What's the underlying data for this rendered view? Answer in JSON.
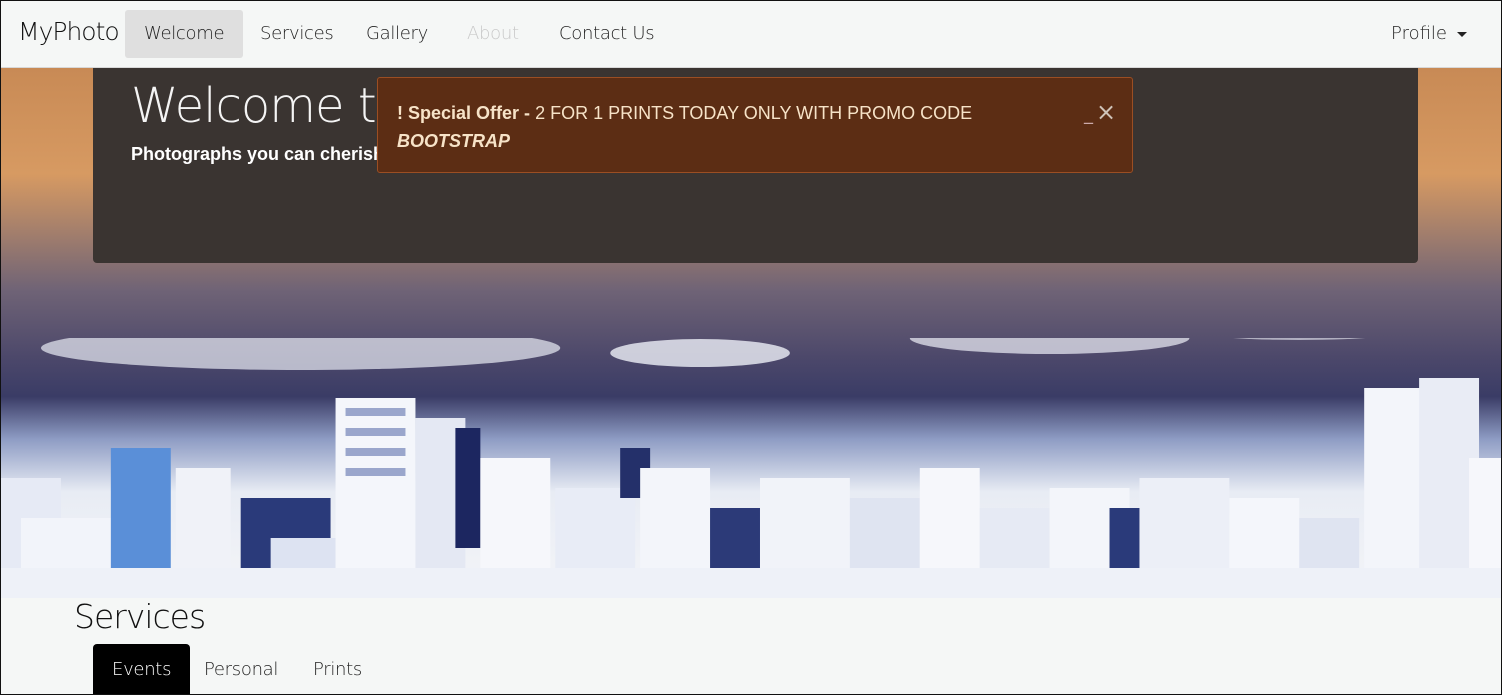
{
  "navbar": {
    "brand": "MyPhoto",
    "items": [
      {
        "label": "Welcome",
        "state": "active"
      },
      {
        "label": "Services",
        "state": "normal"
      },
      {
        "label": "Gallery",
        "state": "normal"
      },
      {
        "label": "About",
        "state": "disabled"
      },
      {
        "label": "Contact Us",
        "state": "normal"
      }
    ],
    "profile_label": "Profile"
  },
  "hero": {
    "title": "Welcome to",
    "subtitle": "Photographs you can cherish!"
  },
  "alert": {
    "icon": "!",
    "prefix": "Special Offer - ",
    "message": "2 FOR 1 PRINTS TODAY ONLY WITH PROMO CODE",
    "code": "BOOTSTRAP",
    "minimize_glyph": "_",
    "close_glyph": "×"
  },
  "services": {
    "title": "Services",
    "tabs": [
      {
        "label": "Events",
        "state": "active"
      },
      {
        "label": "Personal",
        "state": "normal"
      },
      {
        "label": "Prints",
        "state": "normal"
      }
    ]
  },
  "colors": {
    "alert_bg": "#5c2d14",
    "jumbotron_bg": "#3a3431",
    "tab_active_bg": "#000000",
    "nav_active_bg": "#dfdfdf"
  }
}
